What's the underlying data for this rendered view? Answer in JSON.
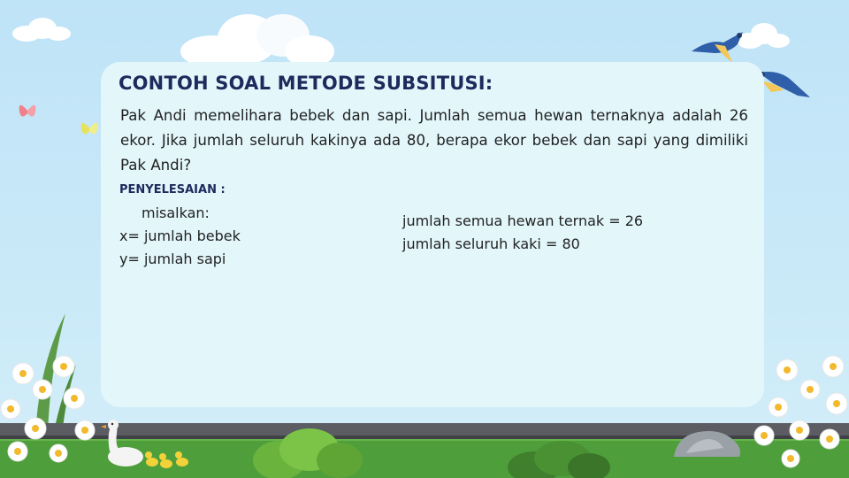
{
  "slide": {
    "title": "CONTOH SOAL METODE SUBSITUSI:",
    "question": "Pak Andi memelihara bebek dan sapi. Jumlah semua hewan ternaknya adalah 26 ekor. Jika jumlah seluruh kakinya ada 80, berapa ekor bebek dan sapi yang dimiliki Pak Andi?",
    "solution_heading": "PENYELESAIAN :",
    "left_lines": [
      "misalkan:",
      "x= jumlah bebek",
      "y= jumlah sapi"
    ],
    "right_lines": [
      "jumlah semua hewan ternak = 26",
      "jumlah seluruh kaki = 80"
    ]
  },
  "icons": [
    "cloud-icon",
    "bird-icon",
    "butterfly-icon",
    "daisy-flower-icon",
    "duck-icon",
    "duckling-icon",
    "bush-icon",
    "rock-icon",
    "grass-blade-icon"
  ],
  "colors": {
    "sky": "#c4e6f8",
    "card": "#e3f7fb",
    "title": "#1c2a5c",
    "text": "#222222",
    "grass": "#4f9e3c",
    "road": "#5b5d62"
  }
}
